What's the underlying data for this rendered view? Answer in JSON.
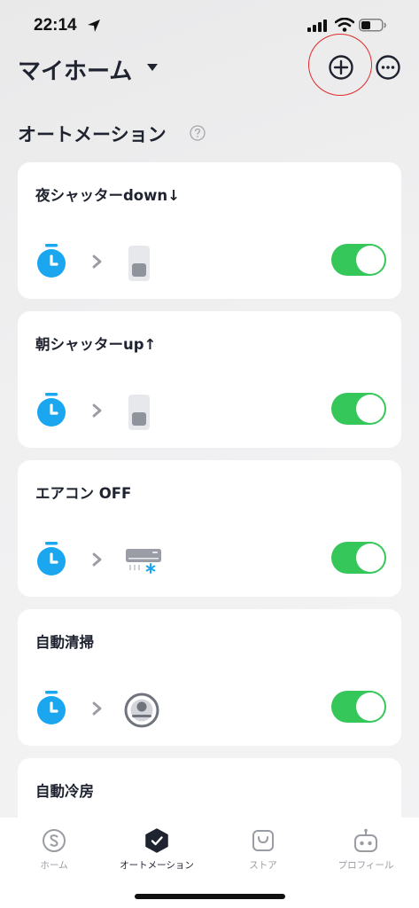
{
  "status_bar": {
    "time": "22:14"
  },
  "header": {
    "home_name": "マイホーム"
  },
  "section": {
    "title": "オートメーション"
  },
  "automations": [
    {
      "title": "夜シャッターdown↓",
      "trigger_icon": "timer-icon",
      "device_icon": "shutter-switch-icon",
      "enabled": true
    },
    {
      "title": "朝シャッターup↑",
      "trigger_icon": "timer-icon",
      "device_icon": "shutter-switch-icon",
      "enabled": true
    },
    {
      "title": "エアコン OFF",
      "trigger_icon": "timer-icon",
      "device_icon": "air-conditioner-icon",
      "enabled": true
    },
    {
      "title": "自動清掃",
      "trigger_icon": "timer-icon",
      "device_icon": "robot-vacuum-icon",
      "enabled": true
    },
    {
      "title": "自動冷房"
    }
  ],
  "bottom_nav": {
    "items": [
      {
        "label": "ホーム",
        "icon": "home-s-icon",
        "active": false
      },
      {
        "label": "オートメーション",
        "icon": "automation-check-icon",
        "active": true
      },
      {
        "label": "ストア",
        "icon": "store-bag-icon",
        "active": false
      },
      {
        "label": "プロフィール",
        "icon": "profile-robot-icon",
        "active": false
      }
    ]
  },
  "colors": {
    "toggle_on": "#35c759",
    "accent_blue": "#1aa7f0",
    "highlight_red": "#e02a2a",
    "text_dark": "#1f2330"
  }
}
